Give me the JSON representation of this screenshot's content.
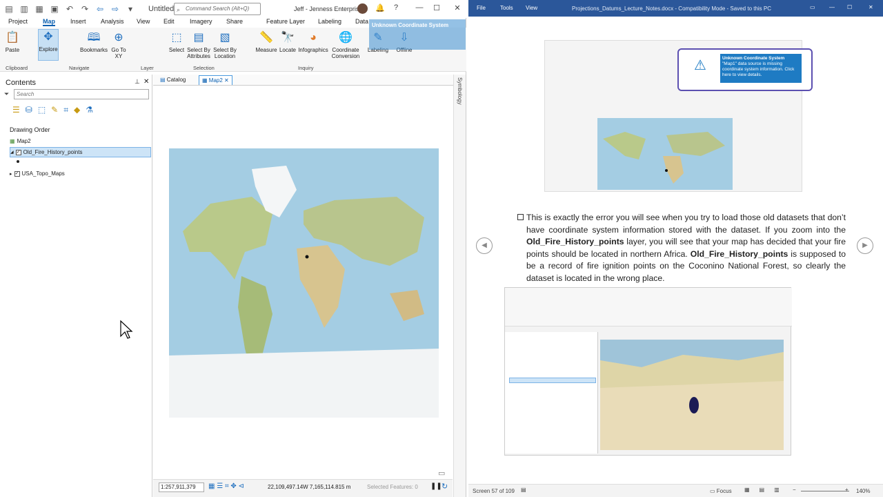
{
  "pro": {
    "untitled": "Untitled",
    "command_search": "Command Search (Alt+Q)",
    "user": "Jeff - Jenness Enterprises",
    "tabs": [
      "Project",
      "Map",
      "Insert",
      "Analysis",
      "View",
      "Edit",
      "Imagery",
      "Share",
      "Feature Layer",
      "Labeling",
      "Data"
    ],
    "ribbon": {
      "paste": "Paste",
      "explore": "Explore",
      "bookmarks": "Bookmarks",
      "goto": "Go To XY",
      "select": "Select",
      "select_attr": "Select By Attributes",
      "select_loc": "Select By Location",
      "measure": "Measure",
      "locate": "Locate",
      "infographics": "Infographics",
      "coord_conv": "Coordinate Conversion",
      "labeling": "Labeling",
      "offline": "Offline"
    },
    "groups": {
      "clipboard": "Clipboard",
      "navigate": "Navigate",
      "layer": "Layer",
      "selection": "Selection",
      "inquiry": "Inquiry"
    },
    "notification": "Unknown Coordinate System",
    "contents": {
      "title": "Contents",
      "search": "Search",
      "drawing_order": "Drawing Order",
      "map": "Map2",
      "layer1": "Old_Fire_History_points",
      "layer2": "USA_Topo_Maps"
    },
    "map_tabs": {
      "catalog": "Catalog",
      "map2": "Map2"
    },
    "status": {
      "scale": "1:257,911,379",
      "coords": "22,109,497.14W 7,165,114.815 m",
      "selected": "Selected Features: 0"
    },
    "symbology": "Symbology"
  },
  "word": {
    "menu": [
      "File",
      "Tools",
      "View"
    ],
    "title": "Projections_Datums_Lecture_Notes.docx  -  Compatibility Mode  -  Saved to this PC",
    "callout_title": "Unknown Coordinate System",
    "callout_body": "\"Map1\" data source is missing coordinate system information. Click here to view details.",
    "para_1": "This is exactly the error you will see when you try to load those old datasets that don’t have coordinate system information stored with the dataset.  If you zoom into the ",
    "para_b1": "Old_Fire_History_points",
    "para_2": " layer, you will see that your map has decided that your fire points should be located in northern Africa.  ",
    "para_b2": "Old_Fire_History_points",
    "para_3": " is supposed to be a record of fire ignition points on the Coconino National Forest, so clearly the dataset is located in the wrong place.",
    "screen": "Screen 57 of 109",
    "focus": "Focus",
    "zoom": "140%"
  },
  "colors": {
    "word_blue": "#2b579a",
    "pro_accent": "#0a5fb0",
    "ocean": "#9dc7df"
  }
}
